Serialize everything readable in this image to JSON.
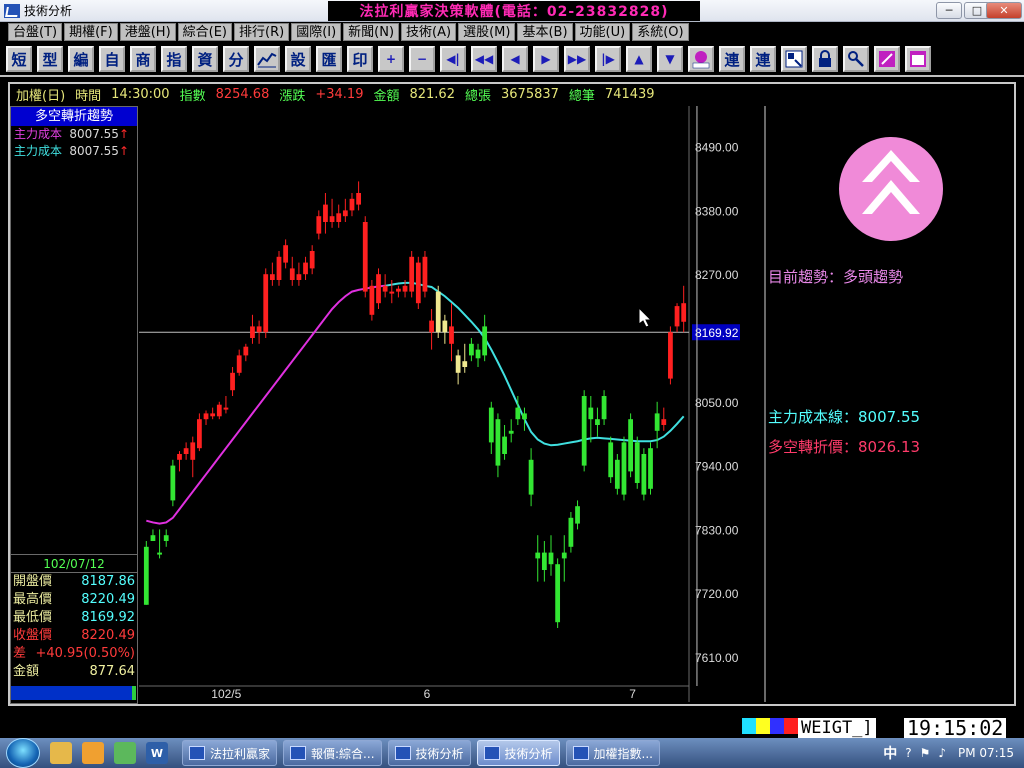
{
  "window": {
    "title": "技術分析",
    "banner": "法拉利贏家決策軟體(電話：02-23832828)",
    "min_label": "─",
    "max_label": "□",
    "close_label": "✕"
  },
  "menu": [
    "台盤(T)",
    "期權(F)",
    "港盤(H)",
    "綜合(E)",
    "排行(R)",
    "國際(I)",
    "新聞(N)",
    "技術(A)",
    "選股(M)",
    "基本(B)",
    "功能(U)",
    "系統(O)"
  ],
  "toolbar": {
    "text_buttons": [
      "短",
      "型",
      "編",
      "自",
      "商",
      "指",
      "資",
      "分"
    ],
    "text_buttons2": [
      "設",
      "匯",
      "印"
    ],
    "symbol_buttons": [
      "+",
      "−",
      "◀|",
      "◀◀",
      "◀",
      "▶",
      "▶▶",
      "|▶",
      "▲",
      "▼"
    ],
    "text_buttons3": [
      "連",
      "連"
    ]
  },
  "infobar": {
    "name": "加權(日)",
    "time_label": "時間",
    "time": "14:30:00",
    "index_label": "指數",
    "index": "8254.68",
    "change_label": "漲跌",
    "change": "+34.19",
    "amount_label": "金額",
    "amount": "821.62",
    "total_sheets_label": "總張",
    "total_sheets": "3675837",
    "total_trades_label": "總筆",
    "total_trades": "741439"
  },
  "left_panel": {
    "title": "多空轉折趨勢",
    "rows": [
      {
        "label": "主力成本",
        "value": "8007.55",
        "arrow": "↑"
      },
      {
        "label": "主力成本",
        "value": "8007.55",
        "arrow": "↑"
      }
    ],
    "ohlc": {
      "date": "102/07/12",
      "open_label": "開盤價",
      "open": "8187.86",
      "high_label": "最高價",
      "high": "8220.49",
      "low_label": "最低價",
      "low": "8169.92",
      "close_label": "收盤價",
      "close": "8220.49",
      "diff_label": "差",
      "diff": "+40.95(0.50%)",
      "amount_label": "金額",
      "amount": "877.64"
    }
  },
  "right_panel": {
    "trend": "目前趨勢：多頭趨勢",
    "cost_line": "主力成本線：8007.55",
    "turn_price": "多空轉折價：8026.13"
  },
  "colors": {
    "up": "#ff2020",
    "down": "#33e633",
    "neutral": "#f0e890",
    "ma_up": "#e030e0",
    "ma_down": "#40e0e0",
    "crosshair": "#c0c0c0",
    "grid_text": "#dcdcdc"
  },
  "chart_data": {
    "type": "candlestick",
    "ylim": [
      7560,
      8560
    ],
    "yticks": [
      8490,
      8380,
      8270,
      8160,
      8050,
      7940,
      7830,
      7720,
      7610
    ],
    "ytick_labels": [
      "8490.00",
      "8380.00",
      "8270.00",
      "8169.92",
      "8050.00",
      "7940.00",
      "7830.00",
      "7720.00",
      "7610.00"
    ],
    "x_labels": [
      "102/5",
      "6",
      "7"
    ],
    "x_label_index": [
      11,
      43,
      74
    ],
    "crosshair_price": 8169.92,
    "crosshair_label": "8169.92",
    "crosshair_index": 83,
    "candles": [
      {
        "o": 7700,
        "h": 7810,
        "l": 7700,
        "c": 7800,
        "t": "d"
      },
      {
        "o": 7820,
        "h": 7830,
        "l": 7810,
        "c": 7810,
        "t": "d"
      },
      {
        "o": 7790,
        "h": 7830,
        "l": 7780,
        "c": 7790,
        "t": "d"
      },
      {
        "o": 7820,
        "h": 7830,
        "l": 7800,
        "c": 7810,
        "t": "d"
      },
      {
        "o": 7880,
        "h": 7950,
        "l": 7870,
        "c": 7940,
        "t": "d"
      },
      {
        "o": 7950,
        "h": 7965,
        "l": 7930,
        "c": 7960,
        "t": "u"
      },
      {
        "o": 7960,
        "h": 7980,
        "l": 7950,
        "c": 7970,
        "t": "u"
      },
      {
        "o": 7950,
        "h": 7990,
        "l": 7920,
        "c": 7980,
        "t": "u"
      },
      {
        "o": 7970,
        "h": 8030,
        "l": 7965,
        "c": 8020,
        "t": "u"
      },
      {
        "o": 8020,
        "h": 8035,
        "l": 8010,
        "c": 8030,
        "t": "u"
      },
      {
        "o": 8030,
        "h": 8040,
        "l": 8020,
        "c": 8025,
        "t": "u"
      },
      {
        "o": 8025,
        "h": 8050,
        "l": 8020,
        "c": 8045,
        "t": "u"
      },
      {
        "o": 8040,
        "h": 8060,
        "l": 8030,
        "c": 8040,
        "t": "u"
      },
      {
        "o": 8070,
        "h": 8110,
        "l": 8060,
        "c": 8100,
        "t": "u"
      },
      {
        "o": 8100,
        "h": 8140,
        "l": 8095,
        "c": 8130,
        "t": "u"
      },
      {
        "o": 8130,
        "h": 8150,
        "l": 8120,
        "c": 8145,
        "t": "u"
      },
      {
        "o": 8160,
        "h": 8200,
        "l": 8150,
        "c": 8180,
        "t": "u"
      },
      {
        "o": 8180,
        "h": 8190,
        "l": 8150,
        "c": 8170,
        "t": "u"
      },
      {
        "o": 8170,
        "h": 8280,
        "l": 8160,
        "c": 8270,
        "t": "u"
      },
      {
        "o": 8270,
        "h": 8290,
        "l": 8250,
        "c": 8260,
        "t": "u"
      },
      {
        "o": 8260,
        "h": 8310,
        "l": 8250,
        "c": 8300,
        "t": "u"
      },
      {
        "o": 8290,
        "h": 8330,
        "l": 8280,
        "c": 8320,
        "t": "u"
      },
      {
        "o": 8260,
        "h": 8300,
        "l": 8250,
        "c": 8280,
        "t": "u"
      },
      {
        "o": 8260,
        "h": 8290,
        "l": 8250,
        "c": 8270,
        "t": "u"
      },
      {
        "o": 8270,
        "h": 8300,
        "l": 8260,
        "c": 8290,
        "t": "u"
      },
      {
        "o": 8280,
        "h": 8320,
        "l": 8270,
        "c": 8310,
        "t": "u"
      },
      {
        "o": 8340,
        "h": 8380,
        "l": 8330,
        "c": 8370,
        "t": "u"
      },
      {
        "o": 8360,
        "h": 8410,
        "l": 8340,
        "c": 8390,
        "t": "u"
      },
      {
        "o": 8370,
        "h": 8400,
        "l": 8350,
        "c": 8360,
        "t": "u"
      },
      {
        "o": 8360,
        "h": 8390,
        "l": 8350,
        "c": 8375,
        "t": "u"
      },
      {
        "o": 8370,
        "h": 8400,
        "l": 8360,
        "c": 8380,
        "t": "u"
      },
      {
        "o": 8380,
        "h": 8410,
        "l": 8370,
        "c": 8400,
        "t": "u"
      },
      {
        "o": 8390,
        "h": 8430,
        "l": 8380,
        "c": 8410,
        "t": "u"
      },
      {
        "o": 8360,
        "h": 8370,
        "l": 8230,
        "c": 8240,
        "t": "u"
      },
      {
        "o": 8250,
        "h": 8260,
        "l": 8190,
        "c": 8200,
        "t": "u"
      },
      {
        "o": 8270,
        "h": 8280,
        "l": 8210,
        "c": 8220,
        "t": "u"
      },
      {
        "o": 8240,
        "h": 8270,
        "l": 8230,
        "c": 8250,
        "t": "u"
      },
      {
        "o": 8240,
        "h": 8260,
        "l": 8220,
        "c": 8240,
        "t": "u"
      },
      {
        "o": 8240,
        "h": 8250,
        "l": 8230,
        "c": 8245,
        "t": "u"
      },
      {
        "o": 8240,
        "h": 8260,
        "l": 8230,
        "c": 8250,
        "t": "u"
      },
      {
        "o": 8300,
        "h": 8310,
        "l": 8230,
        "c": 8240,
        "t": "u"
      },
      {
        "o": 8290,
        "h": 8300,
        "l": 8210,
        "c": 8220,
        "t": "u"
      },
      {
        "o": 8300,
        "h": 8310,
        "l": 8230,
        "c": 8240,
        "t": "u"
      },
      {
        "o": 8190,
        "h": 8210,
        "l": 8140,
        "c": 8170,
        "t": "u"
      },
      {
        "o": 8240,
        "h": 8250,
        "l": 8160,
        "c": 8170,
        "t": "n"
      },
      {
        "o": 8190,
        "h": 8200,
        "l": 8150,
        "c": 8170,
        "t": "n"
      },
      {
        "o": 8180,
        "h": 8220,
        "l": 8120,
        "c": 8150,
        "t": "u"
      },
      {
        "o": 8130,
        "h": 8140,
        "l": 8080,
        "c": 8100,
        "t": "n"
      },
      {
        "o": 8120,
        "h": 8150,
        "l": 8100,
        "c": 8110,
        "t": "n"
      },
      {
        "o": 8150,
        "h": 8160,
        "l": 8120,
        "c": 8130,
        "t": "d"
      },
      {
        "o": 8140,
        "h": 8150,
        "l": 8110,
        "c": 8125,
        "t": "d"
      },
      {
        "o": 8180,
        "h": 8200,
        "l": 8120,
        "c": 8130,
        "t": "d"
      },
      {
        "o": 8040,
        "h": 8050,
        "l": 7960,
        "c": 7980,
        "t": "d"
      },
      {
        "o": 8020,
        "h": 8030,
        "l": 7920,
        "c": 7940,
        "t": "d"
      },
      {
        "o": 7990,
        "h": 8010,
        "l": 7950,
        "c": 7960,
        "t": "d"
      },
      {
        "o": 8000,
        "h": 8020,
        "l": 7980,
        "c": 7995,
        "t": "d"
      },
      {
        "o": 8040,
        "h": 8060,
        "l": 8010,
        "c": 8020,
        "t": "d"
      },
      {
        "o": 8020,
        "h": 8040,
        "l": 8000,
        "c": 8030,
        "t": "d"
      },
      {
        "o": 7950,
        "h": 7970,
        "l": 7870,
        "c": 7890,
        "t": "d"
      },
      {
        "o": 7780,
        "h": 7820,
        "l": 7740,
        "c": 7790,
        "t": "d"
      },
      {
        "o": 7790,
        "h": 7810,
        "l": 7740,
        "c": 7760,
        "t": "d"
      },
      {
        "o": 7790,
        "h": 7820,
        "l": 7750,
        "c": 7770,
        "t": "d"
      },
      {
        "o": 7770,
        "h": 7780,
        "l": 7660,
        "c": 7670,
        "t": "d"
      },
      {
        "o": 7790,
        "h": 7820,
        "l": 7740,
        "c": 7780,
        "t": "d"
      },
      {
        "o": 7850,
        "h": 7860,
        "l": 7790,
        "c": 7800,
        "t": "d"
      },
      {
        "o": 7870,
        "h": 7880,
        "l": 7830,
        "c": 7840,
        "t": "d"
      },
      {
        "o": 8060,
        "h": 8070,
        "l": 7930,
        "c": 7940,
        "t": "d"
      },
      {
        "o": 8020,
        "h": 8060,
        "l": 7980,
        "c": 8040,
        "t": "d"
      },
      {
        "o": 8010,
        "h": 8040,
        "l": 7990,
        "c": 8020,
        "t": "d"
      },
      {
        "o": 8060,
        "h": 8070,
        "l": 8010,
        "c": 8020,
        "t": "d"
      },
      {
        "o": 7980,
        "h": 7990,
        "l": 7910,
        "c": 7920,
        "t": "d"
      },
      {
        "o": 7950,
        "h": 7960,
        "l": 7890,
        "c": 7900,
        "t": "d"
      },
      {
        "o": 7980,
        "h": 7990,
        "l": 7880,
        "c": 7890,
        "t": "d"
      },
      {
        "o": 8020,
        "h": 8030,
        "l": 7920,
        "c": 7930,
        "t": "d"
      },
      {
        "o": 7980,
        "h": 7990,
        "l": 7900,
        "c": 7910,
        "t": "d"
      },
      {
        "o": 7960,
        "h": 7970,
        "l": 7880,
        "c": 7890,
        "t": "d"
      },
      {
        "o": 7970,
        "h": 7980,
        "l": 7890,
        "c": 7900,
        "t": "d"
      },
      {
        "o": 8000,
        "h": 8050,
        "l": 7970,
        "c": 8030,
        "t": "d"
      },
      {
        "o": 8020,
        "h": 8040,
        "l": 8000,
        "c": 8010,
        "t": "u"
      },
      {
        "o": 8090,
        "h": 8180,
        "l": 8080,
        "c": 8170,
        "t": "u"
      },
      {
        "o": 8180,
        "h": 8220,
        "l": 8170,
        "c": 8215,
        "t": "u"
      },
      {
        "o": 8188,
        "h": 8250,
        "l": 8170,
        "c": 8220,
        "t": "u"
      }
    ],
    "ma": [
      7845,
      7842,
      7840,
      7842,
      7850,
      7865,
      7880,
      7895,
      7910,
      7925,
      7940,
      7955,
      7970,
      7985,
      8000,
      8015,
      8030,
      8045,
      8060,
      8075,
      8090,
      8105,
      8120,
      8135,
      8150,
      8165,
      8180,
      8195,
      8210,
      8222,
      8232,
      8240,
      8243,
      8245,
      8247,
      8249,
      8250,
      8252,
      8254,
      8255,
      8255,
      8253,
      8250,
      8248,
      8240,
      8232,
      8222,
      8212,
      8200,
      8188,
      8175,
      8160,
      8140,
      8118,
      8095,
      8070,
      8045,
      8020,
      7998,
      7985,
      7978,
      7975,
      7976,
      7978,
      7980,
      7982,
      7985,
      7987,
      7988,
      7987,
      7986,
      7985,
      7984,
      7983,
      7982,
      7982,
      7982,
      7984,
      7990,
      8000,
      8012,
      8025
    ],
    "ma_switch_index": 36
  }
}
